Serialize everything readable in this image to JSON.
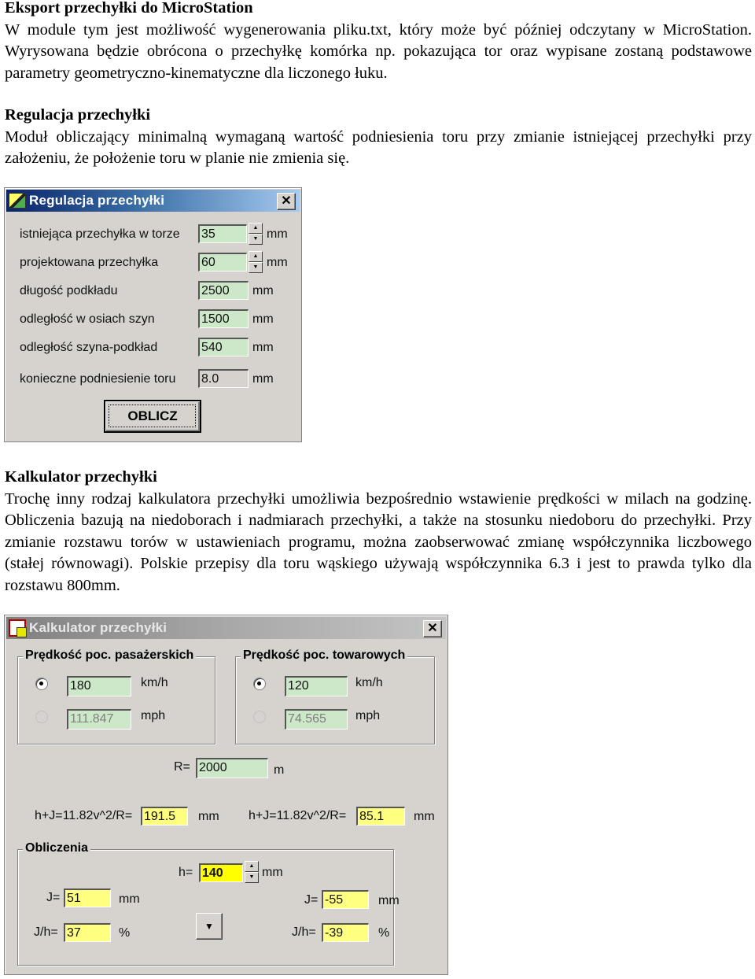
{
  "sections": [
    {
      "heading": "Eksport przechyłki do MicroStation",
      "body": "W module tym jest możliwość wygenerowania pliku.txt, który może być później odczytany w MicroStation. Wyrysowana będzie obrócona o przechyłkę komórka np. pokazująca tor oraz wypisane zostaną podstawowe parametry geometryczno-kinematyczne dla liczonego łuku."
    },
    {
      "heading": "Regulacja przechyłki",
      "body": "Moduł obliczający minimalną wymaganą wartość podniesienia toru przy zmianie istniejącej przechyłki przy założeniu, że położenie toru w planie nie zmienia się."
    },
    {
      "heading": "Kalkulator przechyłki",
      "body": "Trochę inny rodzaj kalkulatora przechyłki umożliwia bezpośrednio wstawienie prędkości w milach na godzinę. Obliczenia bazują na niedoborach i nadmiarach przechyłki, a także na stosunku niedoboru do przechyłki. Przy zmianie rozstawu torów w ustawieniach programu, można zaobserwować zmianę współczynnika liczbowego (stałej równowagi). Polskie przepisy dla toru wąskiego używają współczynnika 6.3 i jest to prawda tylko dla rozstawu 800mm."
    }
  ],
  "regulacja_dialog": {
    "title": "Regulacja przechyłki",
    "close_glyph": "✕",
    "rows": [
      {
        "label": "istniejąca przechyłka w torze",
        "value": "35",
        "unit": "mm"
      },
      {
        "label": "projektowana przechyłka",
        "value": "60",
        "unit": "mm"
      },
      {
        "label": "długość podkładu",
        "value": "2500",
        "unit": "mm"
      },
      {
        "label": "odległość w osiach szyn",
        "value": "1500",
        "unit": "mm"
      },
      {
        "label": "odległość szyna-podkład",
        "value": "540",
        "unit": "mm"
      },
      {
        "label": "konieczne podniesienie toru",
        "value": "8.0",
        "unit": "mm"
      }
    ],
    "button_label": "OBLICZ"
  },
  "kalkulator_dialog": {
    "title": "Kalkulator przechyłki",
    "close_glyph": "✕",
    "passenger": {
      "group_title": "Prędkość poc. pasażerskich",
      "kmh_value": "180",
      "kmh_unit": "km/h",
      "mph_value": "111.847",
      "mph_unit": "mph",
      "selected": "kmh"
    },
    "freight": {
      "group_title": "Prędkość poc. towarowych",
      "kmh_value": "120",
      "kmh_unit": "km/h",
      "mph_value": "74.565",
      "mph_unit": "mph",
      "selected": "kmh"
    },
    "radius": {
      "label": "R=",
      "value": "2000",
      "unit": "m"
    },
    "formula_left": {
      "label": "h+J=11.82v^2/R=",
      "value": "191.5",
      "unit": "mm"
    },
    "formula_right": {
      "label": "h+J=11.82v^2/R=",
      "value": "85.1",
      "unit": "mm"
    },
    "calc": {
      "group_title": "Obliczenia",
      "h_label": "h=",
      "h_value": "140",
      "h_unit": "mm",
      "j_left_label": "J=",
      "j_left_value": "51",
      "j_left_unit": "mm",
      "jh_left_label": "J/h=",
      "jh_left_value": "37",
      "jh_left_unit": "%",
      "j_right_label": "J=",
      "j_right_value": "-55",
      "j_right_unit": "mm",
      "jh_right_label": "J/h=",
      "jh_right_value": "-39",
      "jh_right_unit": "%",
      "dropdown_glyph": "▼"
    }
  },
  "colors": {
    "active_title_start": "#0a246a",
    "active_title_end": "#a6caf0",
    "inactive_title_start": "#808080",
    "inactive_title_end": "#c0c0c0",
    "dialog_face": "#d6d3ce",
    "field_green": "#cde7c9",
    "field_yellow": "#ffff80",
    "field_bright_yellow": "#ffff00"
  }
}
